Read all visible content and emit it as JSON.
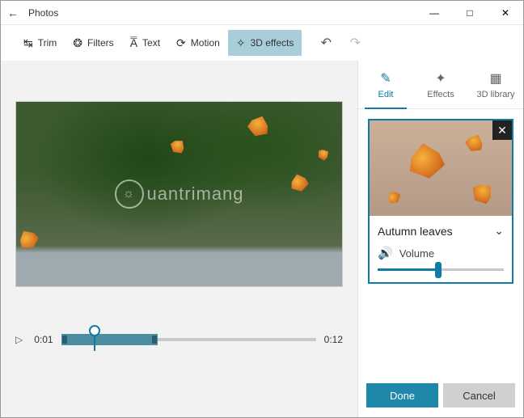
{
  "window": {
    "title": "Photos"
  },
  "toolbar": {
    "trim": "Trim",
    "filters": "Filters",
    "text": "Text",
    "motion": "Motion",
    "effects3d": "3D effects"
  },
  "timeline": {
    "current": "0:01",
    "total": "0:12"
  },
  "panel_tabs": {
    "edit": "Edit",
    "effects": "Effects",
    "library": "3D library"
  },
  "effect": {
    "name": "Autumn leaves",
    "volume_label": "Volume",
    "volume_percent": 48
  },
  "buttons": {
    "done": "Done",
    "cancel": "Cancel"
  },
  "watermark": {
    "text": "uantrimang"
  }
}
